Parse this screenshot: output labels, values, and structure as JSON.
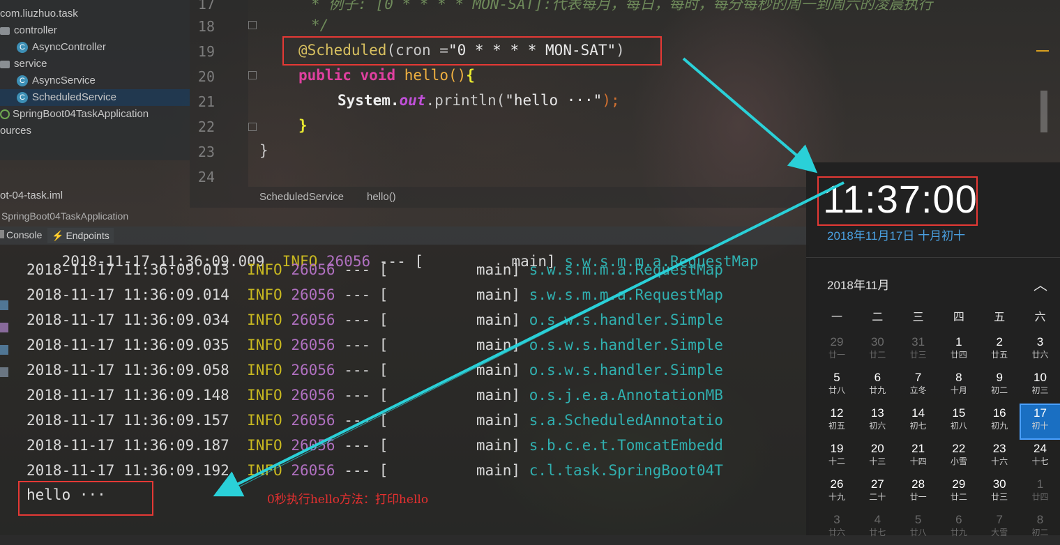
{
  "project_tree": {
    "items": [
      {
        "label": "com.liuzhuo.task",
        "type": "package"
      },
      {
        "label": "controller",
        "type": "package"
      },
      {
        "label": "AsyncController",
        "type": "class"
      },
      {
        "label": "service",
        "type": "package"
      },
      {
        "label": "AsyncService",
        "type": "class"
      },
      {
        "label": "ScheduledService",
        "type": "class"
      },
      {
        "label": "SpringBoot04TaskApplication",
        "type": "app"
      },
      {
        "label": "ources",
        "type": "folder"
      }
    ],
    "iml_file": "ot-04-task.iml",
    "run_config": "SpringBoot04TaskApplication"
  },
  "editor": {
    "lines": [
      "17",
      "18",
      "19",
      "20",
      "21",
      "22",
      "23",
      "24"
    ],
    "comment_17": "* 例子: [0 * * * * MON-SAT]:代表每月，每日，每时，每分每秒的周一到周六的凌晨执行",
    "comment_18": "*/",
    "annotation": "@Scheduled",
    "annotation_args_open": "(cron =",
    "cron_value": "\"0 * * * * MON-SAT\"",
    "annotation_close": ")",
    "kw_public": "public",
    "kw_void": "void",
    "method_name": "hello",
    "method_paren": "()",
    "open_brace": "{",
    "system": "System.",
    "out": "out",
    "println": ".println(",
    "println_arg": "\"hello ···\"",
    "println_end": ");",
    "close_brace": "}",
    "class_close": "}"
  },
  "breadcrumb": {
    "class": "ScheduledService",
    "method": "hello()"
  },
  "toolbar": {
    "console_tab": "Console",
    "endpoints_tab": "Endpoints"
  },
  "console": {
    "partial_row": {
      "ts": "2018-11-17 11:36:09.009",
      "level": "INFO",
      "pid": "26056",
      "sep": "--- [",
      "thread": "main]",
      "logger": "s.w.s.m.m.a.RequestMap"
    },
    "rows": [
      {
        "ts": "2018-11-17 11:36:09.013",
        "level": "INFO",
        "pid": "26056",
        "sep": "--- [",
        "thread": "main]",
        "logger": "s.w.s.m.m.a.RequestMap"
      },
      {
        "ts": "2018-11-17 11:36:09.014",
        "level": "INFO",
        "pid": "26056",
        "sep": "--- [",
        "thread": "main]",
        "logger": "s.w.s.m.m.a.RequestMap"
      },
      {
        "ts": "2018-11-17 11:36:09.034",
        "level": "INFO",
        "pid": "26056",
        "sep": "--- [",
        "thread": "main]",
        "logger": "o.s.w.s.handler.Simple"
      },
      {
        "ts": "2018-11-17 11:36:09.035",
        "level": "INFO",
        "pid": "26056",
        "sep": "--- [",
        "thread": "main]",
        "logger": "o.s.w.s.handler.Simple"
      },
      {
        "ts": "2018-11-17 11:36:09.058",
        "level": "INFO",
        "pid": "26056",
        "sep": "--- [",
        "thread": "main]",
        "logger": "o.s.w.s.handler.Simple"
      },
      {
        "ts": "2018-11-17 11:36:09.148",
        "level": "INFO",
        "pid": "26056",
        "sep": "--- [",
        "thread": "main]",
        "logger": "o.s.j.e.a.AnnotationMB"
      },
      {
        "ts": "2018-11-17 11:36:09.157",
        "level": "INFO",
        "pid": "26056",
        "sep": "--- [",
        "thread": "main]",
        "logger": "s.a.ScheduledAnnotatio"
      },
      {
        "ts": "2018-11-17 11:36:09.187",
        "level": "INFO",
        "pid": "26056",
        "sep": "--- [",
        "thread": "main]",
        "logger": "s.b.c.e.t.TomcatEmbedd"
      },
      {
        "ts": "2018-11-17 11:36:09.192",
        "level": "INFO",
        "pid": "26056",
        "sep": "--- [",
        "thread": "main]",
        "logger": "c.l.task.SpringBoot04T"
      }
    ],
    "hello_output": "hello ···",
    "annotation_note": "0秒执行hello方法：打印hello"
  },
  "clock": {
    "time": "11:37:00",
    "date": "2018年11月17日 十月初十",
    "month": "2018年11月",
    "weekdays": [
      "一",
      "二",
      "三",
      "四",
      "五",
      "六"
    ],
    "weeks": [
      [
        {
          "d": "29",
          "l": "廿一",
          "dim": true
        },
        {
          "d": "30",
          "l": "廿二",
          "dim": true
        },
        {
          "d": "31",
          "l": "廿三",
          "dim": true
        },
        {
          "d": "1",
          "l": "廿四"
        },
        {
          "d": "2",
          "l": "廿五"
        },
        {
          "d": "3",
          "l": "廿六"
        }
      ],
      [
        {
          "d": "5",
          "l": "廿八"
        },
        {
          "d": "6",
          "l": "廿九"
        },
        {
          "d": "7",
          "l": "立冬"
        },
        {
          "d": "8",
          "l": "十月"
        },
        {
          "d": "9",
          "l": "初二"
        },
        {
          "d": "10",
          "l": "初三"
        }
      ],
      [
        {
          "d": "12",
          "l": "初五"
        },
        {
          "d": "13",
          "l": "初六"
        },
        {
          "d": "14",
          "l": "初七"
        },
        {
          "d": "15",
          "l": "初八"
        },
        {
          "d": "16",
          "l": "初九"
        },
        {
          "d": "17",
          "l": "初十",
          "today": true
        }
      ],
      [
        {
          "d": "19",
          "l": "十二"
        },
        {
          "d": "20",
          "l": "十三"
        },
        {
          "d": "21",
          "l": "十四"
        },
        {
          "d": "22",
          "l": "小雪"
        },
        {
          "d": "23",
          "l": "十六"
        },
        {
          "d": "24",
          "l": "十七"
        }
      ],
      [
        {
          "d": "26",
          "l": "十九"
        },
        {
          "d": "27",
          "l": "二十"
        },
        {
          "d": "28",
          "l": "廿一"
        },
        {
          "d": "29",
          "l": "廿二"
        },
        {
          "d": "30",
          "l": "廿三"
        },
        {
          "d": "1",
          "l": "廿四",
          "dim": true
        }
      ],
      [
        {
          "d": "3",
          "l": "廿六",
          "dim": true
        },
        {
          "d": "4",
          "l": "廿七",
          "dim": true
        },
        {
          "d": "5",
          "l": "廿八",
          "dim": true
        },
        {
          "d": "6",
          "l": "廿九",
          "dim": true
        },
        {
          "d": "7",
          "l": "大雪",
          "dim": true
        },
        {
          "d": "8",
          "l": "初二",
          "dim": true
        }
      ]
    ]
  },
  "colors": {
    "highlight_box": "#e53935",
    "arrow": "#2ad0d8",
    "accent": "#4aa0e0",
    "today": "#1a6fc2"
  }
}
